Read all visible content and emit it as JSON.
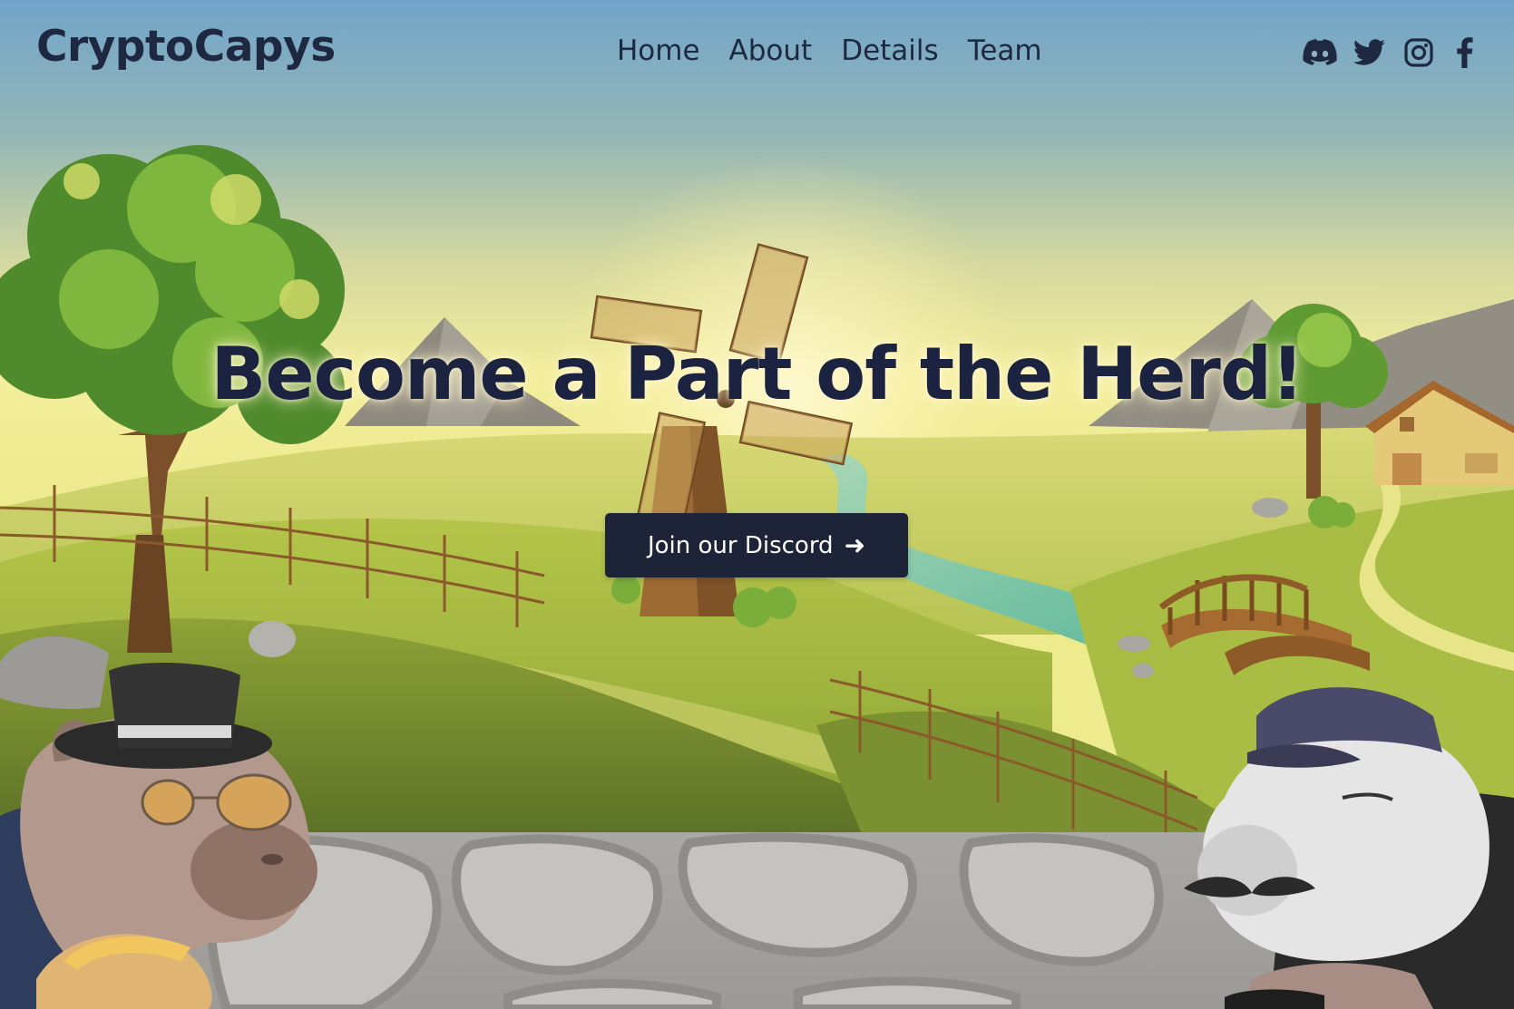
{
  "brand": {
    "name": "CryptoCapys"
  },
  "nav": {
    "items": [
      {
        "label": "Home"
      },
      {
        "label": "About"
      },
      {
        "label": "Details"
      },
      {
        "label": "Team"
      }
    ]
  },
  "social": {
    "icons": [
      "discord-icon",
      "twitter-icon",
      "instagram-icon",
      "facebook-icon"
    ]
  },
  "hero": {
    "title": "Become a Part of the Herd!",
    "cta_label": "Join our Discord",
    "cta_arrow": "➜"
  },
  "colors": {
    "text_dark": "#1e2840",
    "button_bg": "#1d2437",
    "sky_top": "#74a6c9",
    "sky_mid": "#e9e79a",
    "grass": "#9ab53e",
    "wall": "#bdbcb8"
  }
}
